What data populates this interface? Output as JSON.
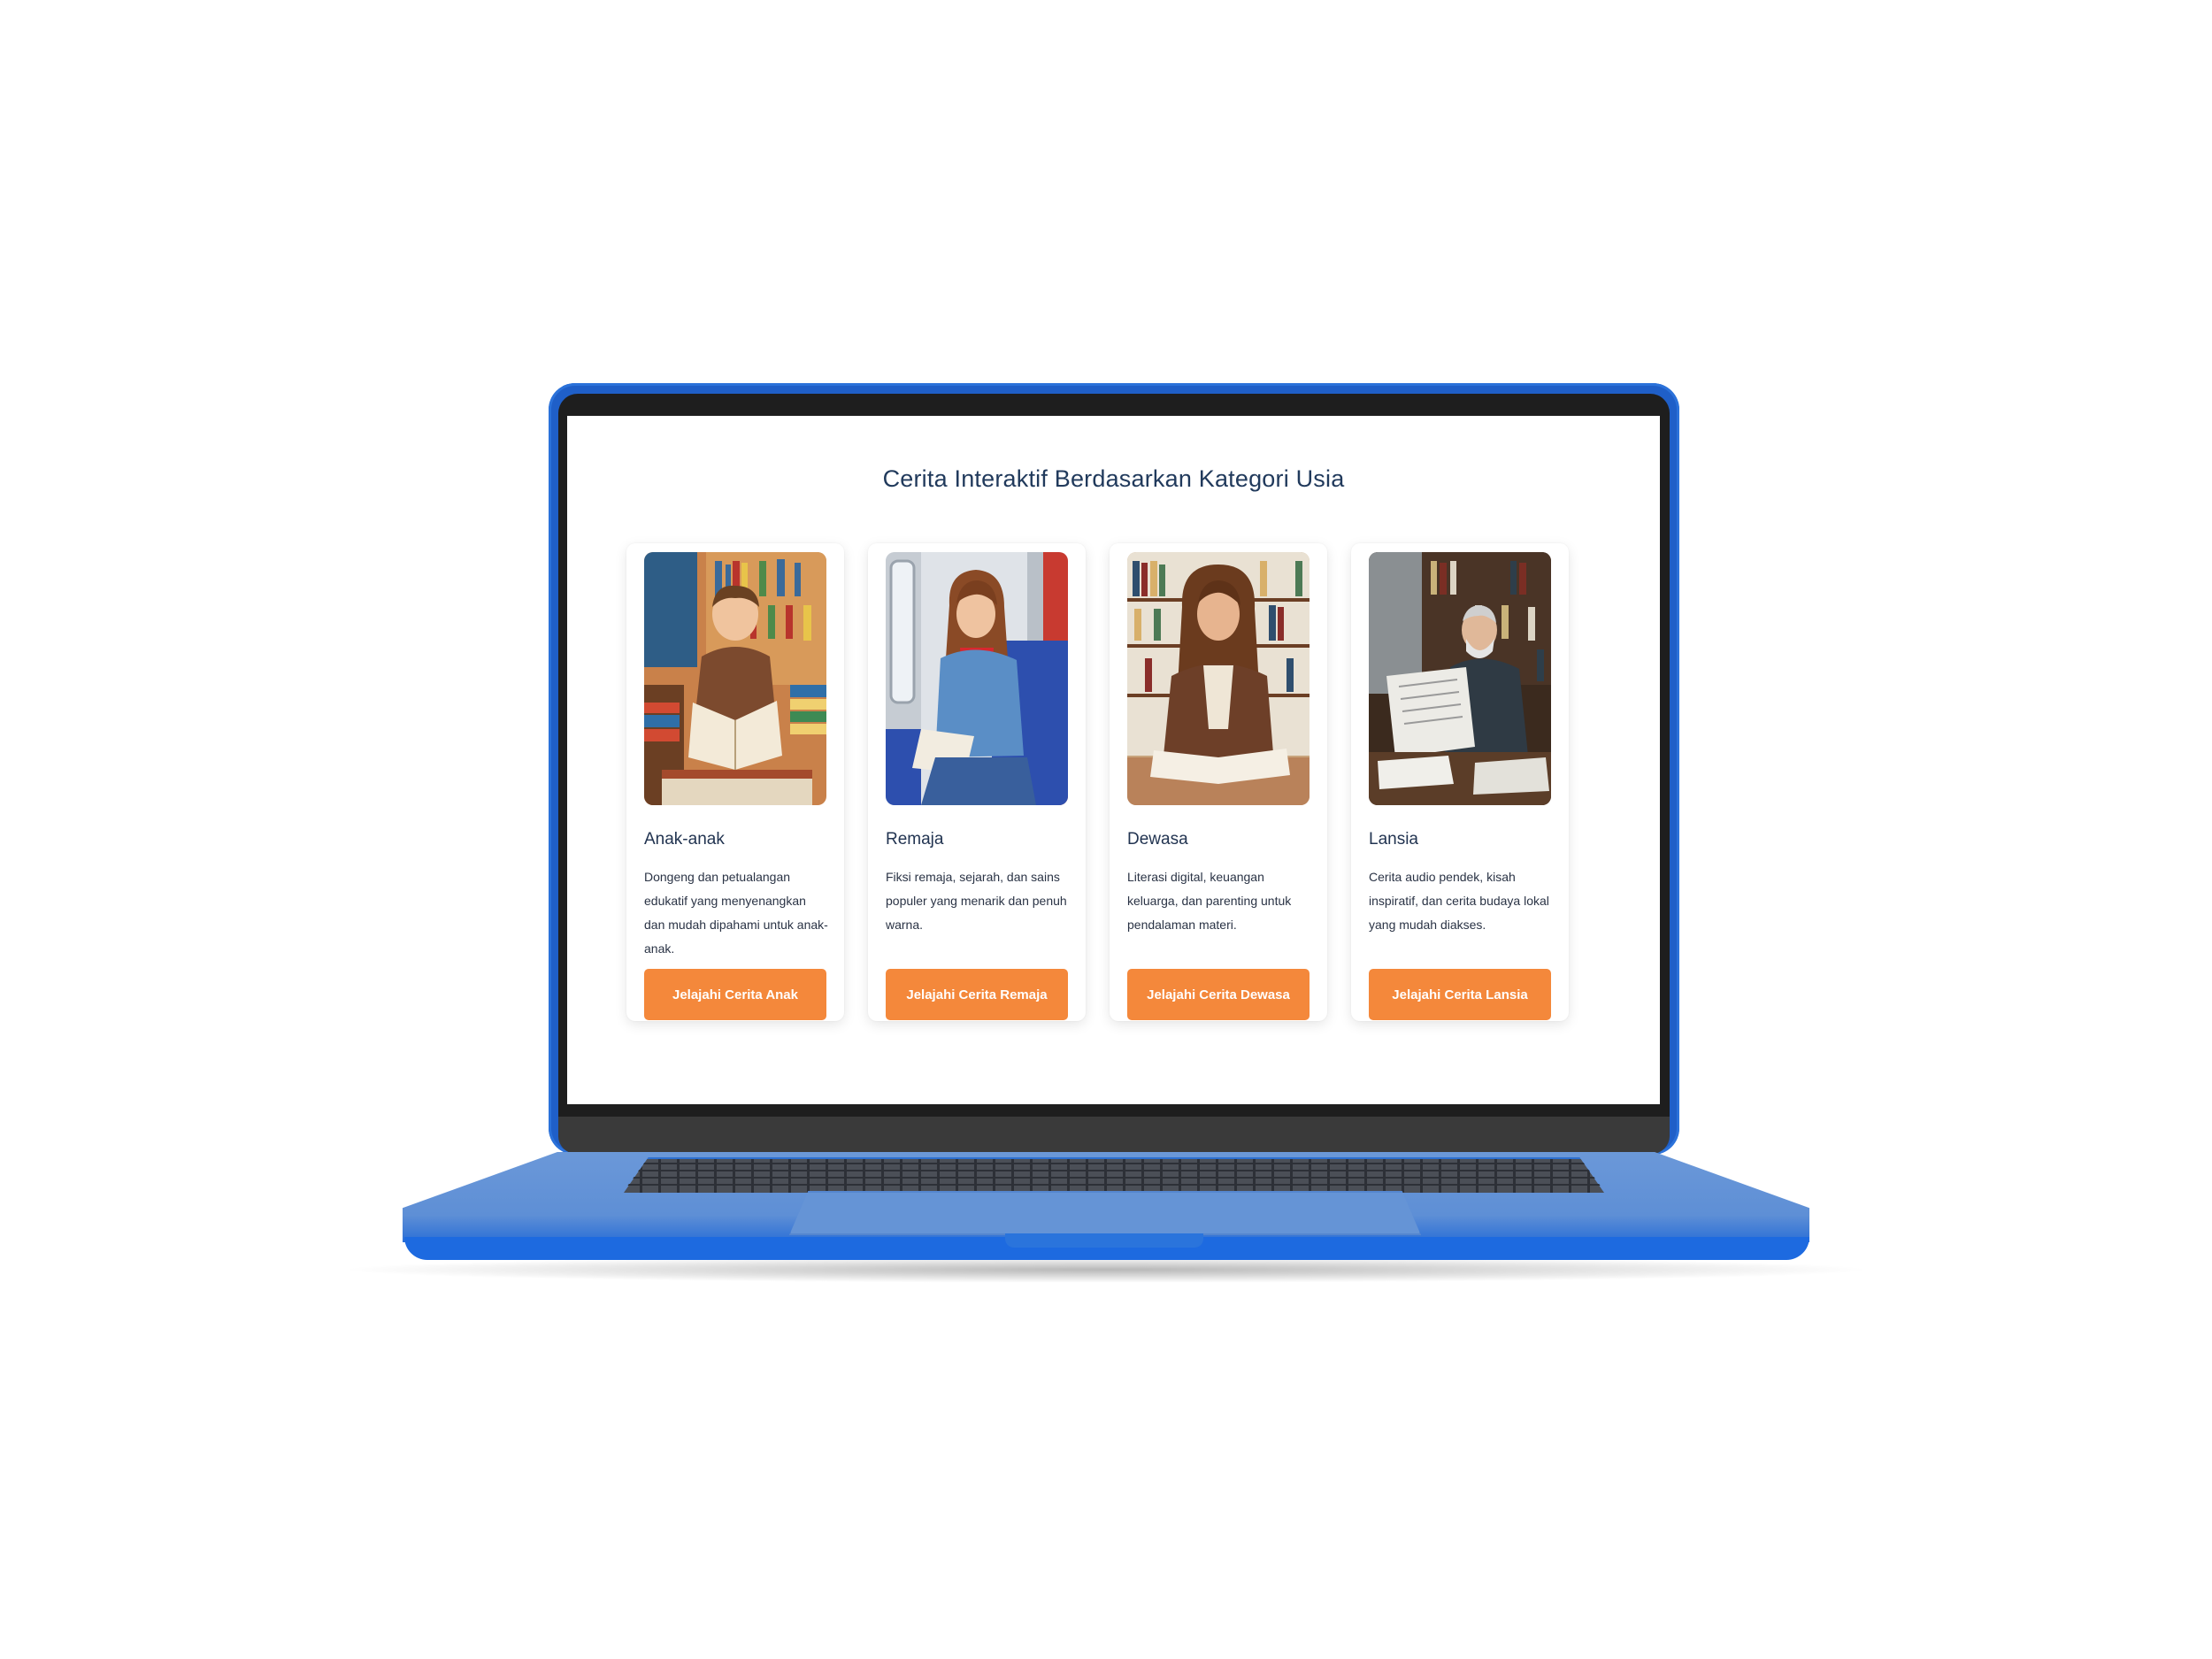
{
  "page": {
    "title": "Cerita Interaktif Berdasarkan Kategori Usia"
  },
  "categories": [
    {
      "name": "Anak-anak",
      "description": "Dongeng dan petualangan edukatif yang menyenangkan dan mudah dipahami untuk anak-anak.",
      "button_label": "Jelajahi Cerita Anak"
    },
    {
      "name": "Remaja",
      "description": "Fiksi remaja, sejarah, dan sains populer yang menarik dan penuh warna.",
      "button_label": "Jelajahi Cerita Remaja"
    },
    {
      "name": "Dewasa",
      "description": "Literasi digital, keuangan keluarga, dan parenting untuk pendalaman materi.",
      "button_label": "Jelajahi Cerita Dewasa"
    },
    {
      "name": "Lansia",
      "description": "Cerita audio pendek, kisah inspiratif, dan cerita budaya lokal yang mudah diakses.",
      "button_label": "Jelajahi Cerita Lansia"
    }
  ],
  "colors": {
    "button": "#f4883b",
    "laptop_body": "#1f5fc8",
    "title_text": "#213a5c"
  }
}
